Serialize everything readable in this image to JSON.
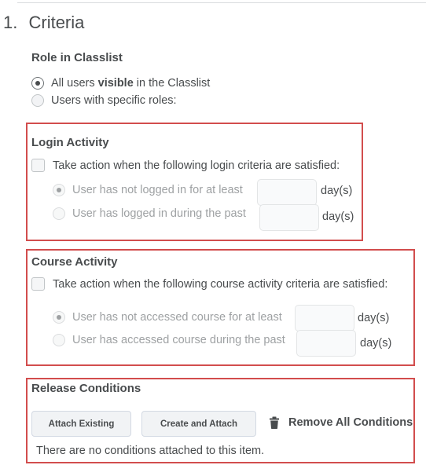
{
  "section": {
    "number": "1.",
    "title": "Criteria"
  },
  "role": {
    "heading": "Role in Classlist",
    "option_all_prefix": "All users ",
    "option_all_bold": "visible",
    "option_all_suffix": " in the Classlist",
    "option_specific": "Users with specific roles:"
  },
  "login": {
    "heading": "Login Activity",
    "checkbox_label": "Take action when the following login criteria are satisfied:",
    "option_not_logged": "User has not logged in for at least",
    "option_logged": "User has logged in during the past",
    "unit": "day(s)"
  },
  "course": {
    "heading": "Course Activity",
    "checkbox_label": "Take action when the following course activity criteria are satisfied:",
    "option_not_accessed": "User has not accessed course for at least",
    "option_accessed": "User has accessed course during the past",
    "unit": "day(s)"
  },
  "release": {
    "heading": "Release Conditions",
    "attach_existing": "Attach Existing",
    "create_and_attach": "Create and Attach",
    "remove_all": "Remove All Conditions",
    "empty_note": "There are no conditions attached to this item."
  },
  "colors": {
    "highlight": "#d24d4d"
  }
}
